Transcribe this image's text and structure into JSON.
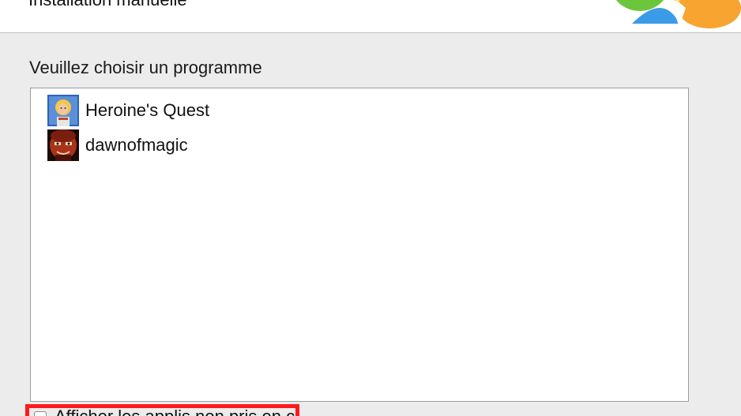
{
  "header": {
    "title": "Installation manuelle"
  },
  "main": {
    "prompt_label": "Veuillez choisir un programme",
    "programs": [
      {
        "label": "Heroine's Quest",
        "icon": "heroine-quest-app-icon"
      },
      {
        "label": "dawnofmagic",
        "icon": "dawnofmagic-app-icon"
      }
    ],
    "show_all_checkbox": {
      "label": "Afficher les applis non pris en charge",
      "checked": false
    }
  },
  "colors": {
    "highlight_box": "#ff1a1a",
    "logo_green": "#6cc63c",
    "logo_blue": "#3a9be6",
    "logo_orange": "#f7a530",
    "logo_yellow": "#ffd84a"
  }
}
